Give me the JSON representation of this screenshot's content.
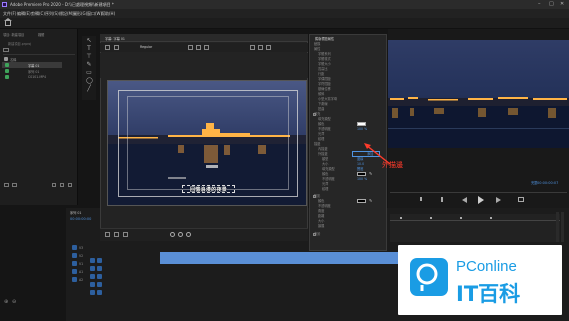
{
  "app": {
    "title": "Adobe Premiere Pro 2020 - D:\\\\已處理視頻\\\\新建項目 *",
    "brand_color": "#9a7cff"
  },
  "window_controls": [
    "–",
    "□",
    "✕"
  ],
  "menu": [
    "文件(F)",
    "編輯(E)",
    "剪輯(C)",
    "序列(S)",
    "標記(M)",
    "圖形(G)",
    "窗口(W)",
    "幫助(H)"
  ],
  "project_panel": {
    "tabs": [
      "項目: 新建項目",
      "媒體"
    ],
    "path": "新建項目.prproj",
    "items": [
      {
        "name": "名稱",
        "color": "#9b9b9b"
      },
      {
        "name": "字幕 01",
        "color": "#3ea35a"
      },
      {
        "name": "序列 01",
        "color": "#3ea35a"
      },
      {
        "name": "C0101.MP4",
        "color": "#3ea35a"
      }
    ]
  },
  "editor": {
    "title": "字幕: 字幕 01",
    "font_label": "Regular",
    "title_text": "回憶浪漫的夜景"
  },
  "properties": {
    "header": "舊版標題屬性",
    "rows": [
      "變換",
      "屬性",
      "字體系列",
      "字體樣式",
      "字體大小",
      "寬高比",
      "行距",
      "字偶間距",
      "字符間距",
      "基線位移",
      "傾斜",
      "小型大寫字母",
      "下劃線",
      "扭曲",
      "填充",
      "填充類型",
      "顏色",
      "不透明度",
      "光澤",
      "紋理",
      "描邊",
      "內描邊",
      "外描邊",
      "類型",
      "大小",
      "填充類型",
      "顏色",
      "不透明度",
      "光澤",
      "紋理",
      "陰影",
      "顏色",
      "不透明度",
      "角度",
      "距離",
      "大小",
      "擴展",
      "背景"
    ],
    "outer_stroke_add": "添加",
    "stroke_type": "邊緣",
    "stroke_size": "10.0",
    "stroke_fill": "實底",
    "opacity": "100 %",
    "annotation_label": "外描邊",
    "colors": {
      "black": "#000000",
      "white": "#ffffff",
      "red": "#e23a2c"
    }
  },
  "program_monitor": {
    "fit_label": "完整",
    "timecode": "00:00:00:07"
  },
  "timeline": {
    "sequence_label": "序列 01",
    "tracks": [
      "V3",
      "V2",
      "V1",
      "A1",
      "A2",
      "A3"
    ],
    "timecode": "00:00:00:00"
  },
  "watermark": {
    "brand_top": "PConline",
    "brand_bottom": "IT百科",
    "brand_color": "#1a9ce4"
  }
}
